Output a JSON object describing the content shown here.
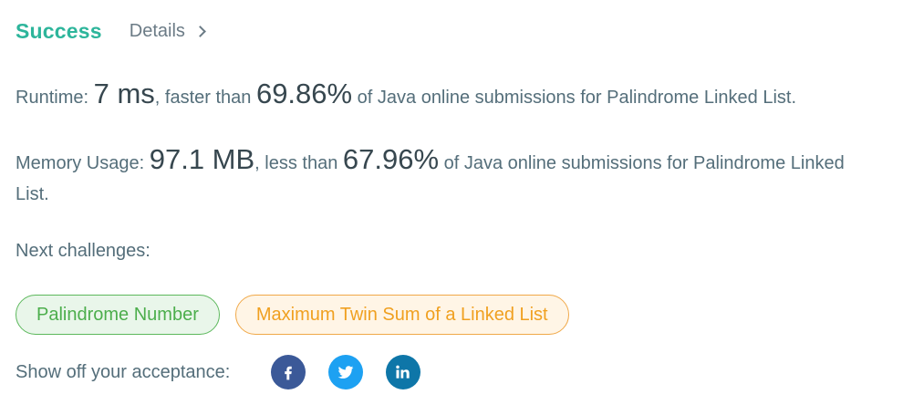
{
  "header": {
    "status": "Success",
    "details_label": "Details"
  },
  "runtime": {
    "label": "Runtime: ",
    "value": "7 ms",
    "comparison": ", faster than ",
    "percent": "69.86%",
    "suffix": " of Java online submissions for Palindrome Linked List."
  },
  "memory": {
    "label": "Memory Usage: ",
    "value": "97.1 MB",
    "comparison": ", less than ",
    "percent": "67.96%",
    "suffix": " of Java online submissions for Palindrome Linked List."
  },
  "next": {
    "label": "Next challenges:",
    "items": [
      {
        "label": "Palindrome Number",
        "color": "#4cae4c"
      },
      {
        "label": "Maximum Twin Sum of a Linked List",
        "color": "#f0a020"
      }
    ]
  },
  "share": {
    "label": "Show off your acceptance:",
    "icons": [
      "facebook-icon",
      "twitter-icon",
      "linkedin-icon"
    ]
  },
  "colors": {
    "success": "#2db59b",
    "facebook": "#3b5998",
    "twitter": "#1da1f2",
    "linkedin": "#0e76a8"
  }
}
